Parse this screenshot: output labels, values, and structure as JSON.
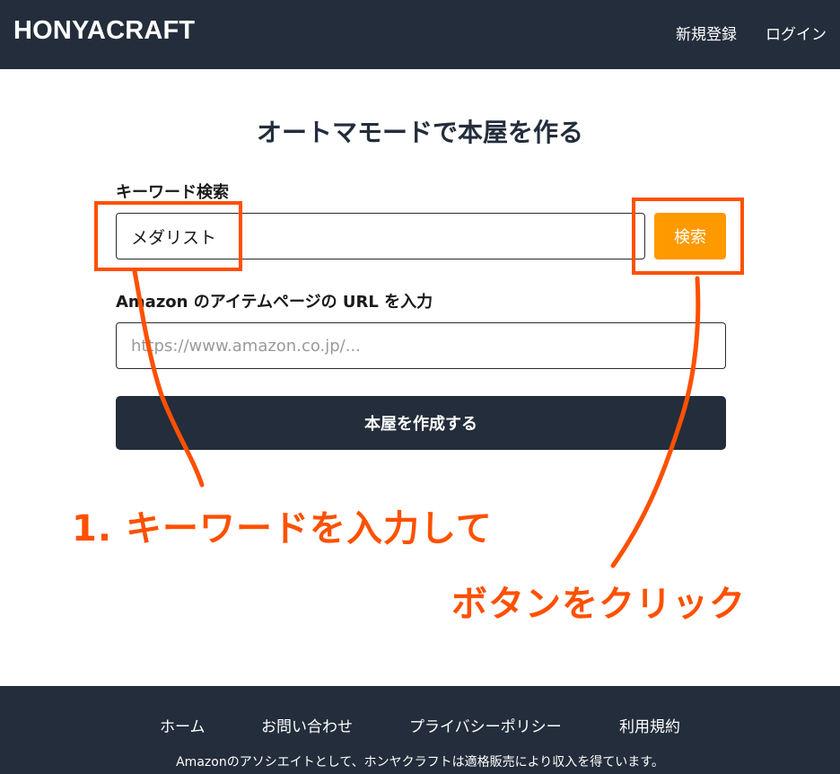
{
  "header": {
    "brand": "HONYACRAFT",
    "nav": {
      "register": "新規登録",
      "login": "ログイン"
    }
  },
  "main": {
    "title": "オートマモードで本屋を作る",
    "keyword": {
      "label": "キーワード検索",
      "value": "メダリスト",
      "search_button": "検索"
    },
    "url": {
      "label": "Amazon のアイテムページの URL を入力",
      "placeholder": "https://www.amazon.co.jp/..."
    },
    "create_button": "本屋を作成する"
  },
  "annotations": {
    "step1": "1. キーワードを入力して",
    "step2": "ボタンをクリック",
    "color": "#fe5000"
  },
  "footer": {
    "links": {
      "home": "ホーム",
      "contact": "お問い合わせ",
      "privacy": "プライバシーポリシー",
      "terms": "利用規約"
    },
    "disclaimer": "Amazonのアソシエイトとして、ホンヤクラフトは適格販売により収入を得ています。"
  },
  "colors": {
    "navy": "#232d3b",
    "accent_orange": "#ff9900",
    "annotation_orange": "#fe5000"
  }
}
